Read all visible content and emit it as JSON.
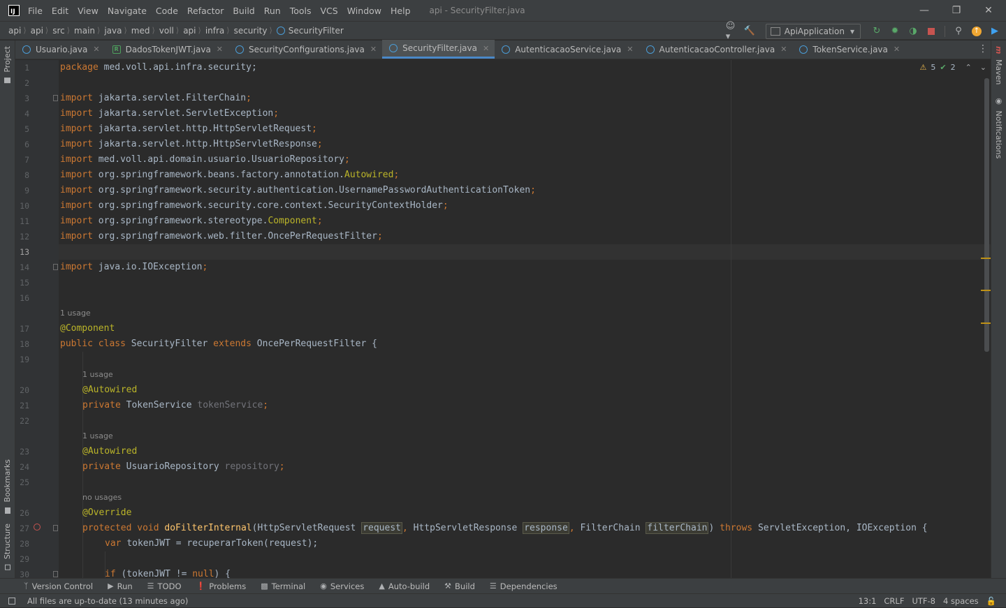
{
  "titlebar": {
    "menu": [
      "File",
      "Edit",
      "View",
      "Navigate",
      "Code",
      "Refactor",
      "Build",
      "Run",
      "Tools",
      "VCS",
      "Window",
      "Help"
    ],
    "window_title": "api - SecurityFilter.java"
  },
  "breadcrumb": [
    "api",
    "api",
    "src",
    "main",
    "java",
    "med",
    "voll",
    "api",
    "infra",
    "security",
    "SecurityFilter"
  ],
  "run_config": "ApiApplication",
  "tabs": [
    {
      "label": "Usuario.java",
      "icon": "class-icon",
      "active": false
    },
    {
      "label": "DadosTokenJWT.java",
      "icon": "record-icon",
      "active": false
    },
    {
      "label": "SecurityConfigurations.java",
      "icon": "class-icon",
      "active": false
    },
    {
      "label": "SecurityFilter.java",
      "icon": "class-icon",
      "active": true
    },
    {
      "label": "AutenticacaoService.java",
      "icon": "class-icon",
      "active": false
    },
    {
      "label": "AutenticacaoController.java",
      "icon": "class-icon",
      "active": false
    },
    {
      "label": "TokenService.java",
      "icon": "class-icon",
      "active": false
    }
  ],
  "side_left": {
    "project": "Project",
    "bookmarks": "Bookmarks",
    "structure": "Structure"
  },
  "side_right": {
    "maven": "Maven",
    "notifications": "Notifications"
  },
  "inspections": {
    "warnings": "5",
    "weak_warnings": "2"
  },
  "code": {
    "line_numbers": [
      "1",
      "2",
      "3",
      "4",
      "5",
      "6",
      "7",
      "8",
      "9",
      "10",
      "11",
      "12",
      "13",
      "14",
      "15",
      "16",
      "17",
      "18",
      "19",
      "20",
      "21",
      "22",
      "23",
      "24",
      "25",
      "26",
      "27",
      "28",
      "29",
      "30"
    ],
    "usage_hints": [
      "1 usage",
      "1 usage",
      "1 usage",
      "no usages"
    ],
    "lines": [
      "package med.voll.api.infra.security;",
      "",
      "import jakarta.servlet.FilterChain;",
      "import jakarta.servlet.ServletException;",
      "import jakarta.servlet.http.HttpServletRequest;",
      "import jakarta.servlet.http.HttpServletResponse;",
      "import med.voll.api.domain.usuario.UsuarioRepository;",
      "import org.springframework.beans.factory.annotation.Autowired;",
      "import org.springframework.security.authentication.UsernamePasswordAuthenticationToken;",
      "import org.springframework.security.core.context.SecurityContextHolder;",
      "import org.springframework.stereotype.Component;",
      "import org.springframework.web.filter.OncePerRequestFilter;",
      "",
      "import java.io.IOException;",
      "",
      "",
      "@Component",
      "public class SecurityFilter extends OncePerRequestFilter {",
      "",
      "    @Autowired",
      "    private TokenService tokenService;",
      "",
      "    @Autowired",
      "    private UsuarioRepository repository;",
      "",
      "    @Override",
      "    protected void doFilterInternal(HttpServletRequest request, HttpServletResponse response, FilterChain filterChain) throws ServletException, IOException {",
      "        var tokenJWT = recuperarToken(request);",
      "",
      "        if (tokenJWT != null) {"
    ]
  },
  "toolwindows": [
    "Version Control",
    "Run",
    "TODO",
    "Problems",
    "Terminal",
    "Services",
    "Auto-build",
    "Build",
    "Dependencies"
  ],
  "status": {
    "message": "All files are up-to-date (13 minutes ago)",
    "caret": "13:1",
    "line_sep": "CRLF",
    "encoding": "UTF-8",
    "indent": "4 spaces"
  },
  "colors": {
    "accent": "#4a88c7",
    "keyword": "#cc7832",
    "annotation": "#bbb529",
    "field": "#9876aa",
    "method": "#ffc66d"
  }
}
